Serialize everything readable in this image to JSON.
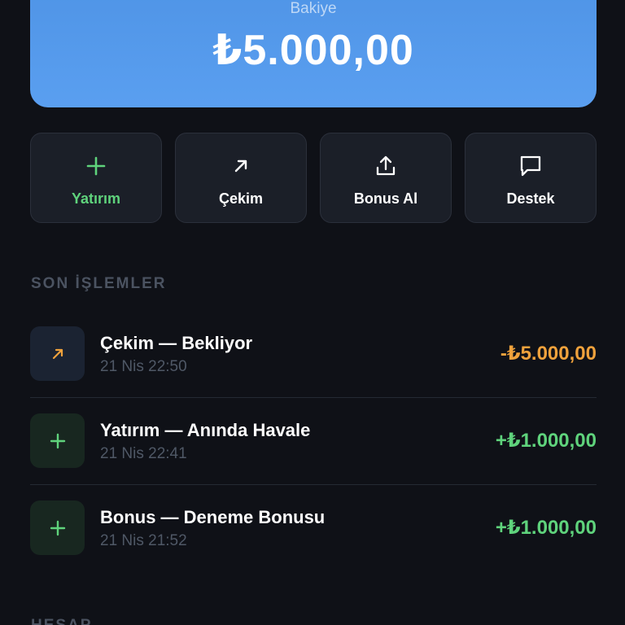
{
  "balance": {
    "label": "Bakiye",
    "amount": "₺5.000,00"
  },
  "actions": [
    {
      "label": "Yatırım",
      "icon": "plus-icon"
    },
    {
      "label": "Çekim",
      "icon": "arrow-up-right-icon"
    },
    {
      "label": "Bonus Al",
      "icon": "share-upload-icon"
    },
    {
      "label": "Destek",
      "icon": "chat-bubble-icon"
    }
  ],
  "recent": {
    "title": "SON İŞLEMLER",
    "items": [
      {
        "title": "Çekim — Bekliyor",
        "time": "21 Nis 22:50",
        "amount": "-₺5.000,00",
        "icon": "arrow-up-right-icon",
        "tone": "orange"
      },
      {
        "title": "Yatırım — Anında Havale",
        "time": "21 Nis 22:41",
        "amount": "+₺1.000,00",
        "icon": "plus-icon",
        "tone": "green"
      },
      {
        "title": "Bonus — Deneme Bonusu",
        "time": "21 Nis 21:52",
        "amount": "+₺1.000,00",
        "icon": "plus-icon",
        "tone": "green"
      }
    ]
  },
  "next_section": {
    "title": "HESAP"
  },
  "colors": {
    "background": "#0f1117",
    "card_blue": "#5a9ff0",
    "green": "#5fd37c",
    "orange": "#f0a23c"
  }
}
